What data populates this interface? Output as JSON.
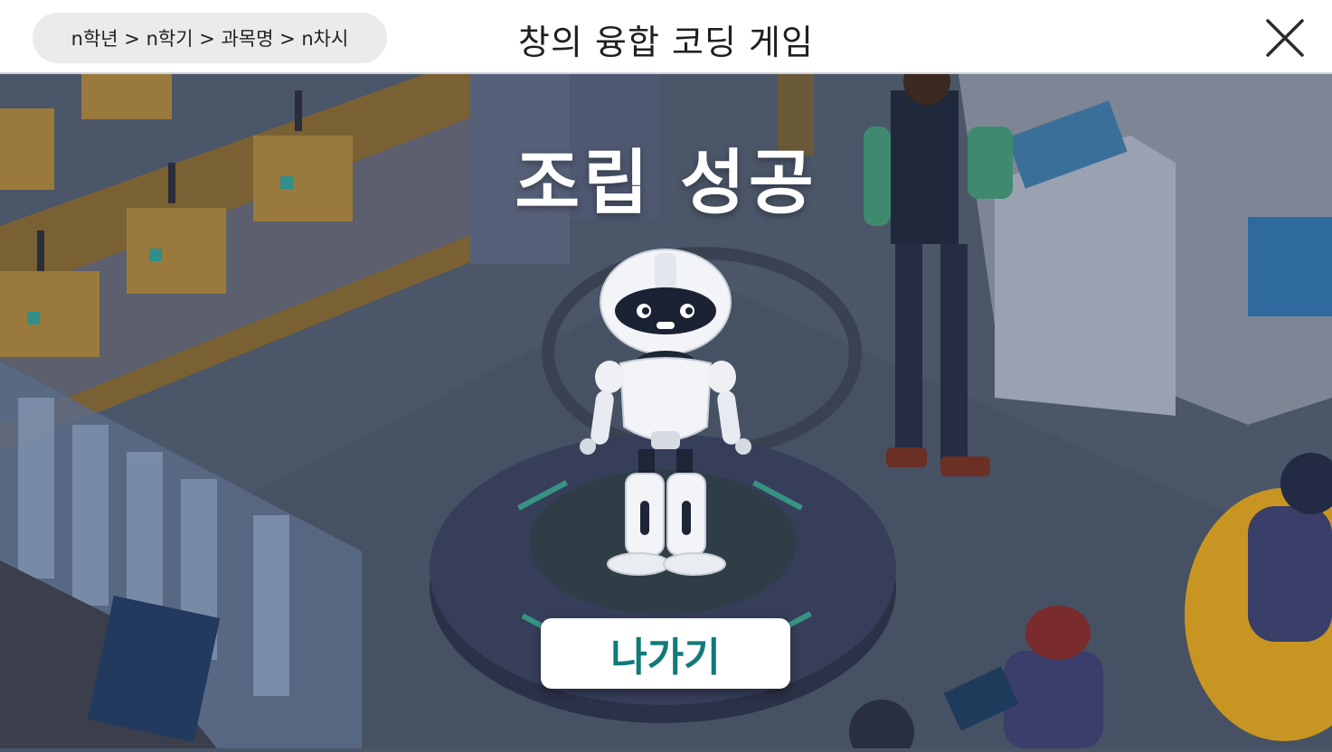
{
  "header": {
    "breadcrumb": "n학년 > n학기 > 과목명 > n차시",
    "title": "창의 융합 코딩 게임",
    "close_icon": "close-icon"
  },
  "result": {
    "headline": "조립 성공",
    "exit_label": "나가기"
  },
  "colors": {
    "header_bg": "#ffffff",
    "scene_bg": "#4a5668",
    "button_text": "#127a78",
    "headline_text": "#ffffff"
  }
}
